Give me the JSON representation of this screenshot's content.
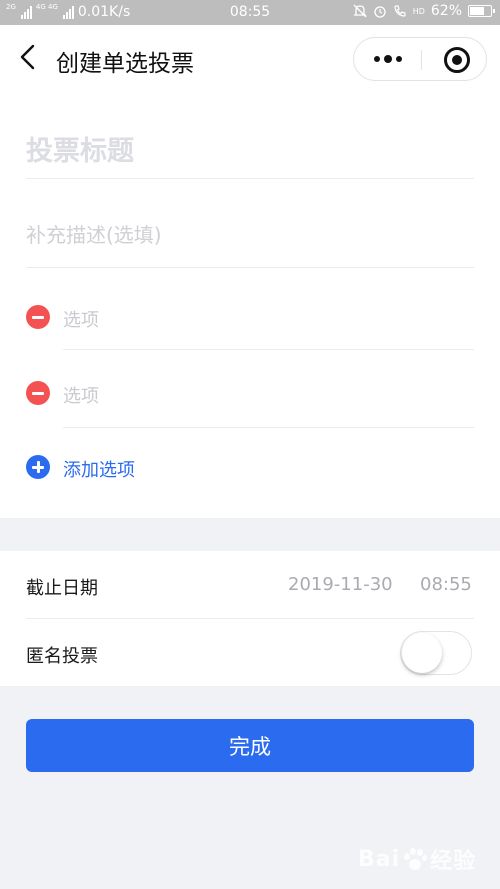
{
  "status_bar": {
    "net_tag_1": "2G",
    "net_tag_2": "4G 4G",
    "speed": "0.01K/s",
    "time": "08:55",
    "hd": "HD",
    "battery": "62%",
    "battery_level": 0.62
  },
  "nav": {
    "title": "创建单选投票",
    "more_icon": "more-dots-icon",
    "close_icon": "target-close-icon"
  },
  "form": {
    "title_placeholder": "投票标题",
    "desc_placeholder": "补充描述(选填)",
    "options": [
      {
        "placeholder": "选项"
      },
      {
        "placeholder": "选项"
      }
    ],
    "add_option_label": "添加选项"
  },
  "settings": {
    "deadline_label": "截止日期",
    "deadline_date": "2019-11-30",
    "deadline_time": "08:55",
    "anonymous_label": "匿名投票",
    "anonymous_on": false
  },
  "done_label": "完成",
  "watermark": {
    "left_text": "Bai",
    "right_text": "经验",
    "url": "jingyan.baidu.com"
  },
  "colors": {
    "accent": "#2b6bf0",
    "remove": "#f45152",
    "page_bg": "#f1f2f6",
    "status_bar": "#bdbdbd"
  }
}
